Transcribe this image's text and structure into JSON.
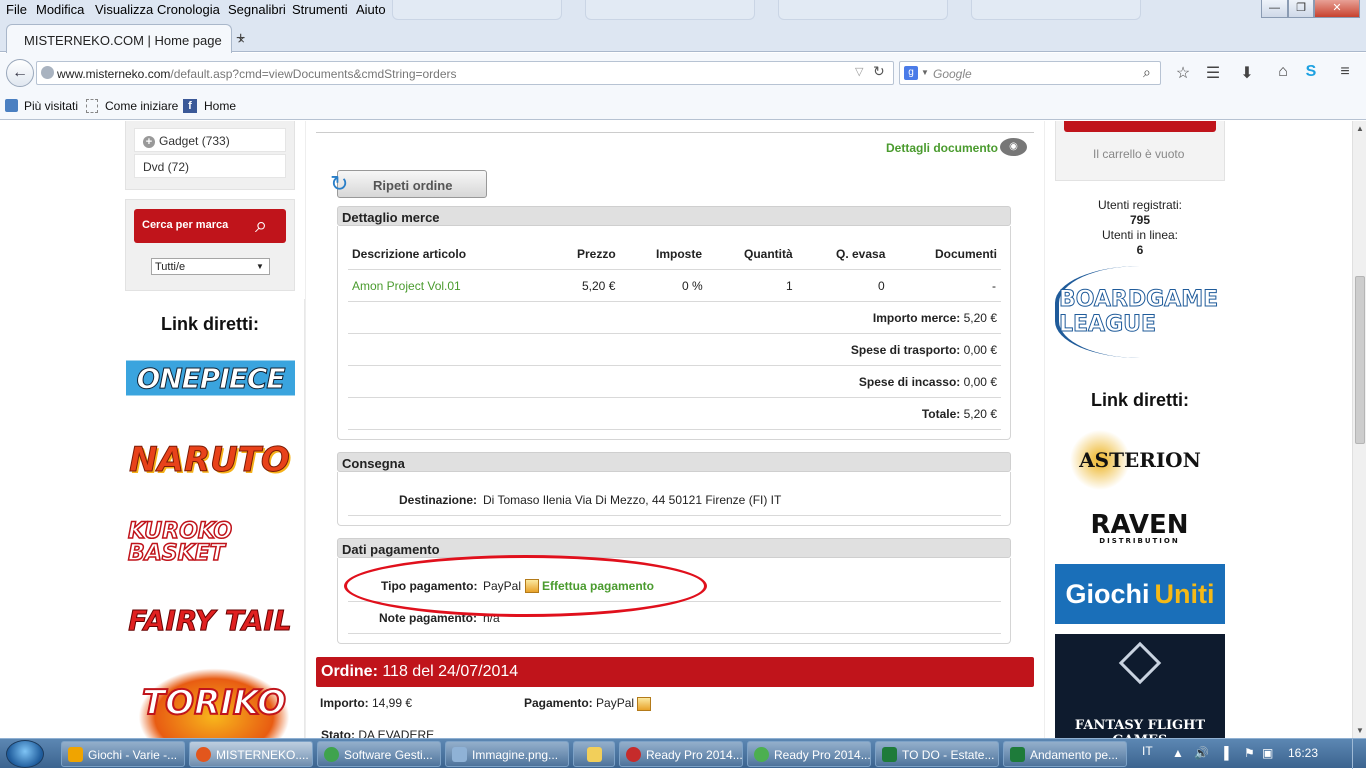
{
  "menu": {
    "items": [
      "File",
      "Modifica",
      "Visualizza",
      "Cronologia",
      "Segnalibri",
      "Strumenti",
      "Aiuto"
    ]
  },
  "tabs": {
    "active_title": "MISTERNEKO.COM | Home page",
    "close_glyph": "×",
    "new_tab_glyph": "+"
  },
  "window": {
    "min": "—",
    "max": "❐",
    "close": "✕"
  },
  "nav": {
    "url_domain": "www.misterneko.com",
    "url_path": "/default.asp?cmd=viewDocuments&cmdString=orders",
    "search_placeholder": "Google"
  },
  "bookmarks": {
    "items": [
      "Più visitati",
      "Come iniziare",
      "Home"
    ]
  },
  "sidebar_left": {
    "categories": [
      {
        "label": "Gadget (733)"
      },
      {
        "label": "Dvd (72)"
      }
    ],
    "brand_search_label": "Cerca per marca",
    "brand_select_value": "Tutti/e",
    "links_title": "Link diretti:",
    "logos": [
      "ONEPIECE",
      "NARUTO",
      "KUROKO BASKET",
      "FAIRY TAIL",
      "TORIKO"
    ]
  },
  "order": {
    "details_link": "Dettagli documento",
    "repeat_button": "Ripeti ordine",
    "goods_section": "Dettaglio merce",
    "columns": [
      "Descrizione articolo",
      "Prezzo",
      "Imposte",
      "Quantità",
      "Q. evasa",
      "Documenti"
    ],
    "rows": [
      {
        "desc": "Amon Project Vol.01",
        "price": "5,20 €",
        "tax": "0 %",
        "qty": "1",
        "shipped": "0",
        "docs": "-"
      }
    ],
    "totals": [
      {
        "label": "Importo merce:",
        "value": "5,20 €"
      },
      {
        "label": "Spese di trasporto:",
        "value": "0,00 €"
      },
      {
        "label": "Spese di incasso:",
        "value": "0,00 €"
      },
      {
        "label": "Totale:",
        "value": "5,20 €"
      }
    ],
    "delivery_section": "Consegna",
    "destination_label": "Destinazione:",
    "destination_value": "Di Tomaso Ilenia Via Di Mezzo, 44 50121 Firenze (FI) IT",
    "payment_section": "Dati pagamento",
    "payment_type_label": "Tipo pagamento:",
    "payment_type_value": "PayPal",
    "pay_link": "Effettua pagamento",
    "payment_note_label": "Note pagamento:",
    "payment_note_value": "n/a"
  },
  "next_order": {
    "title_label": "Ordine:",
    "title_value": "118 del 24/07/2014",
    "amount_label": "Importo:",
    "amount_value": "14,99 €",
    "payment_label": "Pagamento:",
    "payment_value": "PayPal",
    "status_label": "Stato:",
    "status_value": "DA EVADERE"
  },
  "sidebar_right": {
    "cart_empty": "Il carrello è vuoto",
    "registered_label": "Utenti registrati:",
    "registered_value": "795",
    "online_label": "Utenti in linea:",
    "online_value": "6",
    "links_title": "Link diretti:",
    "logos": [
      "BOARDGAME LEAGUE",
      "ASTERION",
      "RAVEN",
      "DISTRIBUTION",
      "Giochi",
      "Uniti",
      "FANTASY FLIGHT GAMES"
    ]
  },
  "taskbar": {
    "items": [
      "Giochi - Varie -...",
      "MISTERNEKO....",
      "Software Gesti...",
      "Immagine.png...",
      "",
      "Ready Pro 2014...",
      "Ready Pro 2014...",
      "TO DO - Estate...",
      "Andamento pe..."
    ],
    "lang": "IT",
    "clock": "16:23"
  },
  "colors": {
    "brand_red": "#c0141b",
    "link_green": "#4a9b2e",
    "annotation_red": "#e0101c"
  }
}
